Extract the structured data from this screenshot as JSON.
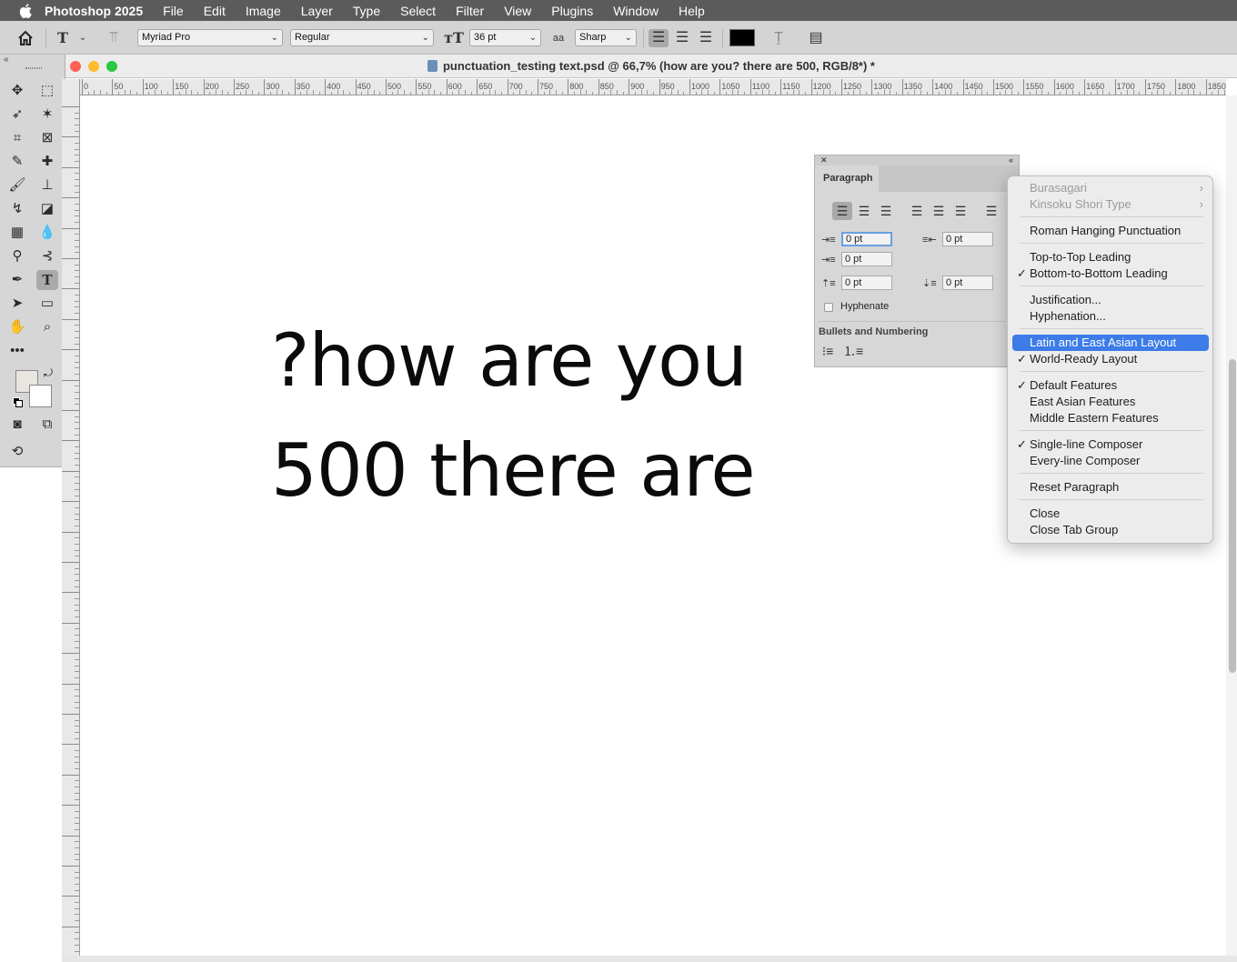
{
  "menubar": {
    "app_name": "Photoshop 2025",
    "items": [
      "File",
      "Edit",
      "Image",
      "Layer",
      "Type",
      "Select",
      "Filter",
      "View",
      "Plugins",
      "Window",
      "Help"
    ]
  },
  "options_bar": {
    "font_family": "Myriad Pro",
    "font_style": "Regular",
    "font_size": "36 pt",
    "antialias_icon": "aa",
    "antialias": "Sharp",
    "text_color": "#000000"
  },
  "document": {
    "title": "punctuation_testing text.psd @ 66,7% (how are you? there are 500, RGB/8*) *"
  },
  "ruler": {
    "h_ticks": [
      "0",
      "50",
      "100",
      "150",
      "200",
      "250",
      "300",
      "350",
      "400",
      "450",
      "500",
      "550",
      "600",
      "650",
      "700",
      "750",
      "800",
      "850",
      "900",
      "950",
      "1000",
      "1050",
      "1100",
      "1150",
      "1200",
      "1250",
      "1300",
      "1350",
      "1400",
      "1450",
      "1500",
      "1550",
      "1600",
      "1650",
      "1700",
      "1750",
      "1800",
      "1850"
    ]
  },
  "canvas": {
    "line1": "?how are you",
    "line2": "500 there are"
  },
  "paragraph_panel": {
    "tab_label": "Paragraph",
    "indent_left": "0 pt",
    "indent_right": "0 pt",
    "first_line": "0 pt",
    "space_before": "0 pt",
    "space_after": "0 pt",
    "hyphenate_label": "Hyphenate",
    "bullets_label": "Bullets and Numbering"
  },
  "context_menu": {
    "burasagari": "Burasagari",
    "kinsoku": "Kinsoku Shori Type",
    "roman_hanging": "Roman Hanging Punctuation",
    "top_to_top": "Top-to-Top Leading",
    "bottom_to_bottom": "Bottom-to-Bottom Leading",
    "justification": "Justification...",
    "hyphenation": "Hyphenation...",
    "latin_east_asian": "Latin and East Asian Layout",
    "world_ready": "World-Ready Layout",
    "default_features": "Default Features",
    "east_asian_features": "East Asian Features",
    "middle_eastern_features": "Middle Eastern Features",
    "single_line": "Single-line Composer",
    "every_line": "Every-line Composer",
    "reset_paragraph": "Reset Paragraph",
    "close": "Close",
    "close_tab_group": "Close Tab Group",
    "check_glyph": "✓"
  }
}
